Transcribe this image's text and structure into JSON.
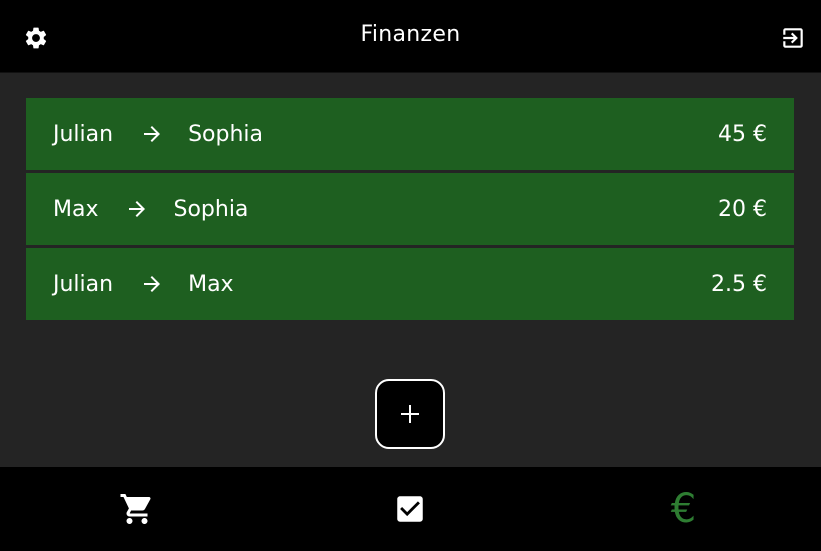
{
  "header": {
    "title": "Finanzen",
    "settings_icon": "gear-icon",
    "logout_icon": "logout-icon"
  },
  "transactions": [
    {
      "from": "Julian",
      "to": "Sophia",
      "amount": "45 €"
    },
    {
      "from": "Max",
      "to": "Sophia",
      "amount": "20 €"
    },
    {
      "from": "Julian",
      "to": "Max",
      "amount": "2.5 €"
    }
  ],
  "add_button": {
    "label": "+"
  },
  "bottom_nav": {
    "items": [
      {
        "name": "shop",
        "icon": "shopping-cart-icon"
      },
      {
        "name": "tasks",
        "icon": "checkbox-icon"
      },
      {
        "name": "finance",
        "icon": "euro-icon",
        "glyph": "€",
        "active": true
      }
    ]
  },
  "colors": {
    "background": "#242424",
    "bar": "#000000",
    "row": "#1e5f20",
    "active_nav": "#2e7d32",
    "text": "#ffffff"
  }
}
